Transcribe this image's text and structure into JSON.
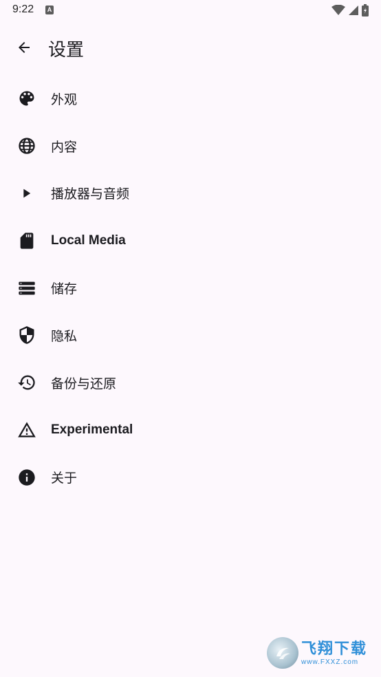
{
  "status_bar": {
    "time": "9:22",
    "notification_glyph": "A",
    "icons": [
      "wifi-icon",
      "signal-icon",
      "battery-icon"
    ]
  },
  "header": {
    "title": "设置",
    "back_icon": "arrow-back-icon"
  },
  "menu": {
    "items": [
      {
        "label": "外观",
        "icon": "palette-icon"
      },
      {
        "label": "内容",
        "icon": "globe-icon"
      },
      {
        "label": "播放器与音频",
        "icon": "play-icon"
      },
      {
        "label": "Local Media",
        "icon": "sd-card-icon"
      },
      {
        "label": "储存",
        "icon": "storage-icon"
      },
      {
        "label": "隐私",
        "icon": "shield-icon"
      },
      {
        "label": "备份与还原",
        "icon": "history-icon"
      },
      {
        "label": "Experimental",
        "icon": "warning-icon"
      },
      {
        "label": "关于",
        "icon": "info-icon"
      }
    ]
  },
  "watermark": {
    "title": "飞翔下载",
    "url": "www.FXXZ.com"
  },
  "colors": {
    "background": "#fdf8fd",
    "text": "#1b1b1f",
    "icon": "#1b1b1f"
  }
}
